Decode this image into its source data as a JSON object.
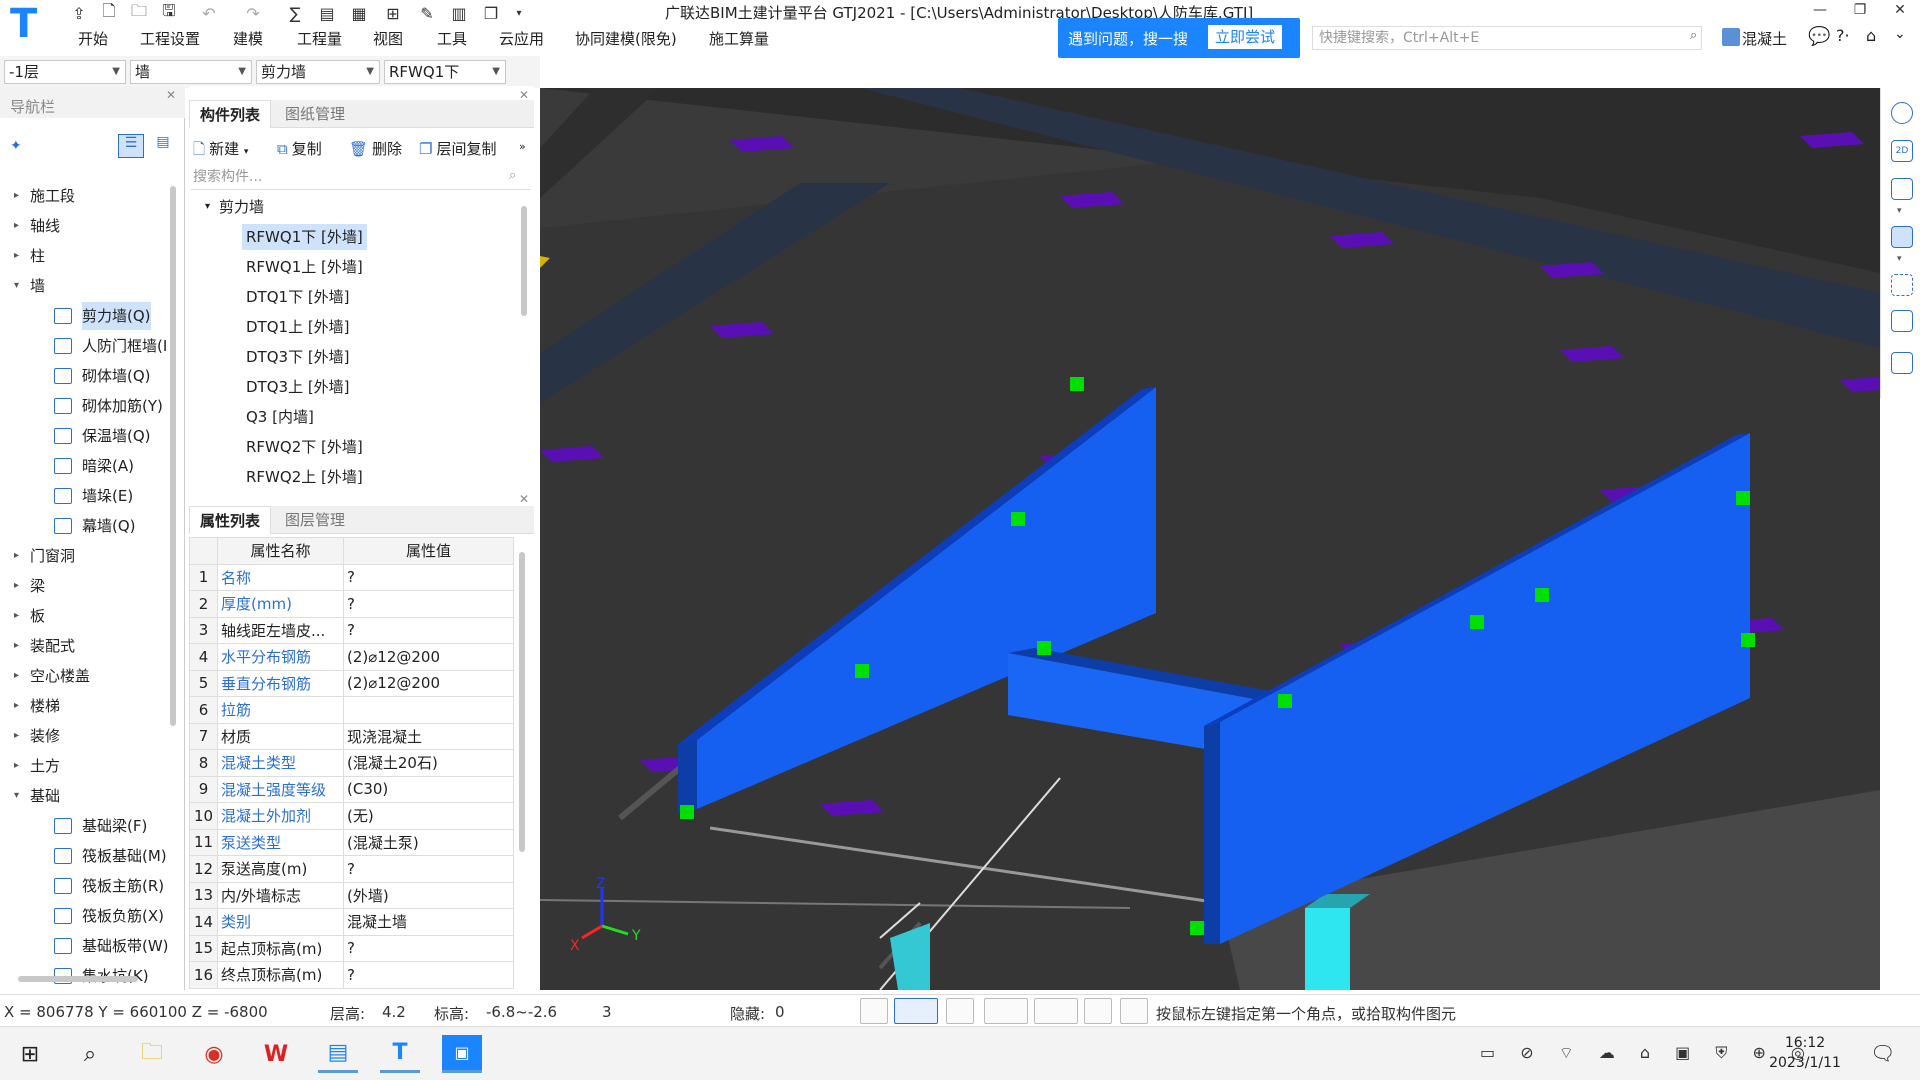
{
  "app": {
    "title": "广联达BIM土建计量平台 GTJ2021 - [C:\\Users\\Administrator\\Desktop\\人防车库.GTJ]",
    "menu": [
      "开始",
      "工程设置",
      "建模",
      "工程量",
      "视图",
      "工具",
      "云应用",
      "协同建模(限免)",
      "施工算量"
    ],
    "help_text": "遇到问题，搜一搜",
    "help_button": "立即尝试",
    "search_placeholder": "快捷键搜索，Ctrl+Alt+E",
    "user_label": "混凝土"
  },
  "selectors": {
    "floor": "-1层",
    "type": "墙",
    "subtype": "剪力墙",
    "component": "RFWQ1下"
  },
  "nav": {
    "title": "导航栏",
    "items": [
      {
        "label": "施工段",
        "expanded": false
      },
      {
        "label": "轴线",
        "expanded": false
      },
      {
        "label": "柱",
        "expanded": false
      },
      {
        "label": "墙",
        "expanded": true
      },
      {
        "label": "剪力墙(Q)",
        "sub": true,
        "selected": true
      },
      {
        "label": "人防门框墙(I",
        "sub": true
      },
      {
        "label": "砌体墙(Q)",
        "sub": true
      },
      {
        "label": "砌体加筋(Y)",
        "sub": true
      },
      {
        "label": "保温墙(Q)",
        "sub": true
      },
      {
        "label": "暗梁(A)",
        "sub": true
      },
      {
        "label": "墙垛(E)",
        "sub": true
      },
      {
        "label": "幕墙(Q)",
        "sub": true
      },
      {
        "label": "门窗洞",
        "expanded": false
      },
      {
        "label": "梁",
        "expanded": false
      },
      {
        "label": "板",
        "expanded": false
      },
      {
        "label": "装配式",
        "expanded": false
      },
      {
        "label": "空心楼盖",
        "expanded": false
      },
      {
        "label": "楼梯",
        "expanded": false
      },
      {
        "label": "装修",
        "expanded": false
      },
      {
        "label": "土方",
        "expanded": false
      },
      {
        "label": "基础",
        "expanded": true
      },
      {
        "label": "基础梁(F)",
        "sub": true
      },
      {
        "label": "筏板基础(M)",
        "sub": true
      },
      {
        "label": "筏板主筋(R)",
        "sub": true
      },
      {
        "label": "筏板负筋(X)",
        "sub": true
      },
      {
        "label": "基础板带(W)",
        "sub": true
      },
      {
        "label": "集水坑(K)",
        "sub": true
      }
    ]
  },
  "components": {
    "tabs": [
      "构件列表",
      "图纸管理"
    ],
    "toolbar": {
      "new": "新建",
      "copy": "复制",
      "delete": "删除",
      "floor_copy": "层间复制"
    },
    "search_placeholder": "搜索构件...",
    "group": "剪力墙",
    "items": [
      "RFWQ1下 [外墙]",
      "RFWQ1上 [外墙]",
      "DTQ1下 [外墙]",
      "DTQ1上 [外墙]",
      "DTQ3下 [外墙]",
      "DTQ3上 [外墙]",
      "Q3 [内墙]",
      "RFWQ2下 [外墙]",
      "RFWQ2上 [外墙]"
    ],
    "selected_index": 0
  },
  "properties": {
    "tabs": [
      "属性列表",
      "图层管理"
    ],
    "col_name": "属性名称",
    "col_value": "属性值",
    "rows": [
      {
        "n": "1",
        "name": "名称",
        "value": "?",
        "blue": true
      },
      {
        "n": "2",
        "name": "厚度(mm)",
        "value": "?",
        "blue": true
      },
      {
        "n": "3",
        "name": "轴线距左墙皮...",
        "value": "?",
        "blue": false
      },
      {
        "n": "4",
        "name": "水平分布钢筋",
        "value": "(2)⌀12@200",
        "blue": true
      },
      {
        "n": "5",
        "name": "垂直分布钢筋",
        "value": "(2)⌀12@200",
        "blue": true
      },
      {
        "n": "6",
        "name": "拉筋",
        "value": "",
        "blue": true
      },
      {
        "n": "7",
        "name": "材质",
        "value": "现浇混凝土",
        "blue": false
      },
      {
        "n": "8",
        "name": "混凝土类型",
        "value": "(混凝土20石)",
        "blue": true
      },
      {
        "n": "9",
        "name": "混凝土强度等级",
        "value": "(C30)",
        "blue": true
      },
      {
        "n": "10",
        "name": "混凝土外加剂",
        "value": "(无)",
        "blue": true
      },
      {
        "n": "11",
        "name": "泵送类型",
        "value": "(混凝土泵)",
        "blue": true
      },
      {
        "n": "12",
        "name": "泵送高度(m)",
        "value": "?",
        "blue": false
      },
      {
        "n": "13",
        "name": "内/外墙标志",
        "value": "(外墙)",
        "blue": false
      },
      {
        "n": "14",
        "name": "类别",
        "value": "混凝土墙",
        "blue": true
      },
      {
        "n": "15",
        "name": "起点顶标高(m)",
        "value": "?",
        "blue": false
      },
      {
        "n": "16",
        "name": "终点顶标高(m)",
        "value": "?",
        "blue": false
      }
    ]
  },
  "status": {
    "coords": "X = 806778 Y = 660100 Z = -6800",
    "floor_height_label": "层高:",
    "floor_height": "4.2",
    "elevation_label": "标高:",
    "elevation": "-6.8~-2.6",
    "count": "3",
    "hidden_label": "隐藏:",
    "hidden": "0",
    "hint": "按鼠标左键指定第一个角点，或拾取构件图元"
  },
  "taskbar": {
    "time": "16:12",
    "date": "2023/1/11"
  },
  "colors": {
    "accent": "#1b84ff",
    "wall": "#1560f0",
    "viewport": "#3a3a3a",
    "marker": "#00e000",
    "pad": "#5a0fb5"
  }
}
